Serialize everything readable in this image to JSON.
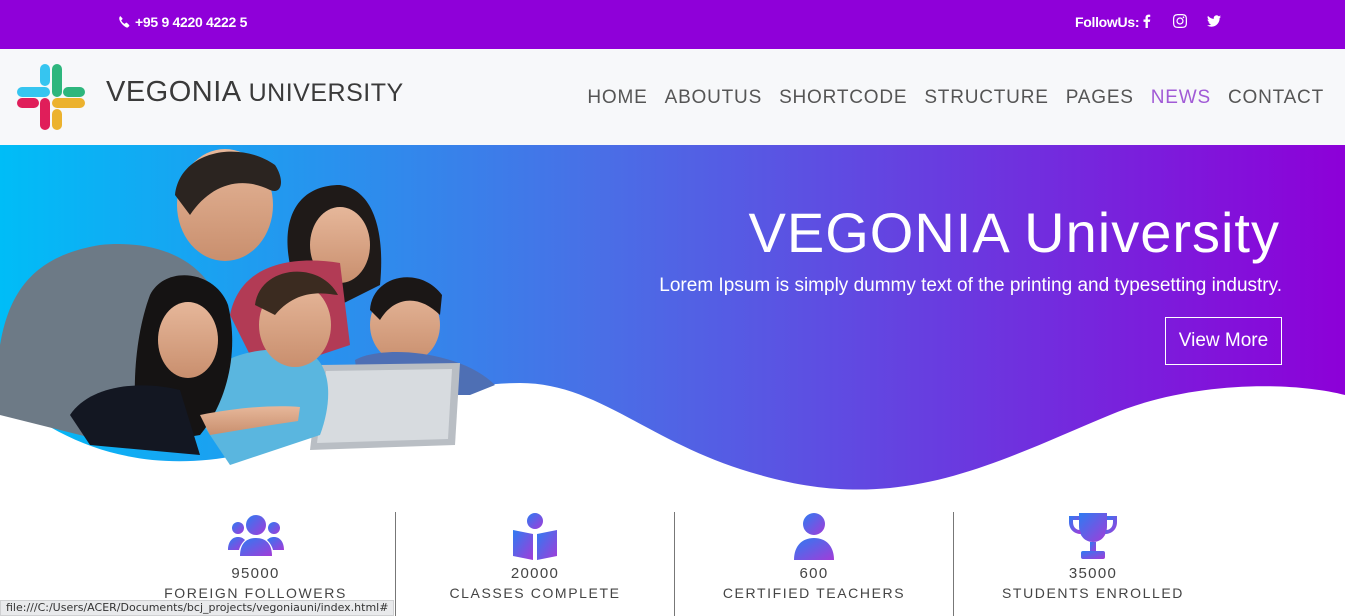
{
  "topbar": {
    "phone": "+95 9 4220 4222 5",
    "follow_label": "FollowUs:",
    "social_icons": [
      "facebook-icon",
      "instagram-icon",
      "twitter-icon"
    ]
  },
  "header": {
    "brand_main": "VEGONIA",
    "brand_sub": "UNIVERSITY",
    "nav": [
      {
        "label": "HOME",
        "active": false
      },
      {
        "label": "ABOUTUS",
        "active": false
      },
      {
        "label": "SHORTCODE",
        "active": false
      },
      {
        "label": "STRUCTURE",
        "active": false
      },
      {
        "label": "PAGES",
        "active": false
      },
      {
        "label": "NEWS",
        "active": true
      },
      {
        "label": "CONTACT",
        "active": false
      }
    ]
  },
  "hero": {
    "title": "VEGONIA University",
    "subtitle": "Lorem Ipsum is simply dummy text of the printing and typesetting industry.",
    "button": "View More",
    "gradient": [
      "#00bdf7",
      "#8d00d8"
    ]
  },
  "stats": [
    {
      "icon": "users-icon",
      "value": "95000",
      "label": "FOREIGN FOLLOWERS"
    },
    {
      "icon": "book-reader-icon",
      "value": "20000",
      "label": "CLASSES COMPLETE"
    },
    {
      "icon": "teacher-icon",
      "value": "600",
      "label": "CERTIFIED TEACHERS"
    },
    {
      "icon": "trophy-icon",
      "value": "35000",
      "label": "STUDENTS ENROLLED"
    }
  ],
  "statusbar": "file:///C:/Users/ACER/Documents/bcj_projects/vegoniauni/index.html#",
  "colors": {
    "topbar": "#8f00d9",
    "nav_active": "#a15ad6",
    "icon_gradient_start": "#2e7bf2",
    "icon_gradient_end": "#a23cd8"
  }
}
